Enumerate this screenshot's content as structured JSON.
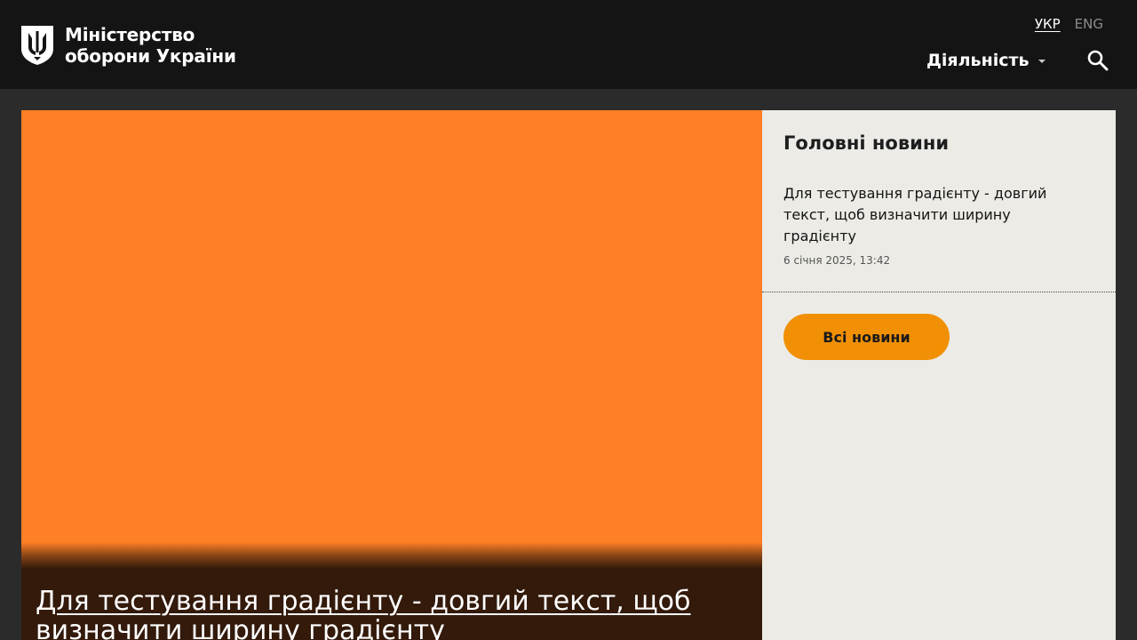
{
  "header": {
    "logo_line1": "Міністерство",
    "logo_line2": "оборони України",
    "lang_active": "УКР",
    "lang_other": "ENG",
    "nav_activity": "Діяльність",
    "icons": {
      "emblem": "trident-emblem-icon",
      "search": "search-icon",
      "caret": "caret-down-icon"
    }
  },
  "hero": {
    "title": "Для тестування градієнту - довгий текст, щоб визначити ширину градієнту",
    "bg_color": "#ff7f27",
    "shade_color": "#331a0b"
  },
  "sidebar": {
    "title": "Головні новини",
    "news": [
      {
        "title": "Для тестування градієнту - довгий текст, щоб визначити ширину градієнту",
        "date": "6 січня 2025, 13:42"
      }
    ],
    "all_news_label": "Всі новини",
    "accent_color": "#f19004"
  }
}
